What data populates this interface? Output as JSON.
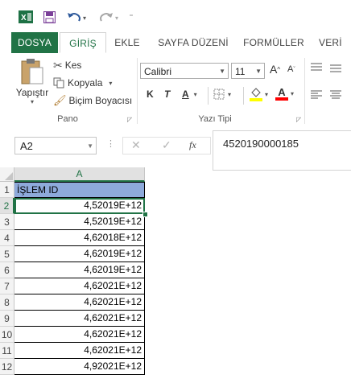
{
  "quick_access": {
    "excel_icon": "excel-logo-icon",
    "save_icon": "save-icon",
    "undo_icon": "undo-icon",
    "redo_icon": "redo-icon"
  },
  "tabs": [
    "DOSYA",
    "GİRİŞ",
    "EKLE",
    "SAYFA DÜZENİ",
    "FORMÜLLER",
    "VERİ"
  ],
  "ribbon": {
    "pano": {
      "paste_label": "Yapıştır",
      "cut_label": "Kes",
      "copy_label": "Kopyala",
      "format_painter_label": "Biçim Boyacısı",
      "group_label": "Pano"
    },
    "font": {
      "font_name": "Calibri",
      "font_size": "11",
      "bold": "K",
      "italic": "T",
      "underline": "A",
      "grow": "A",
      "shrink": "A",
      "font_color": "A",
      "group_label": "Yazı Tipi"
    }
  },
  "formula_bar": {
    "name_box": "A2",
    "fx": "fx",
    "value": "4520190000185"
  },
  "sheet": {
    "col_header": "A",
    "rows": [
      {
        "num": "1",
        "value": "İŞLEM ID"
      },
      {
        "num": "2",
        "value": "4,52019E+12"
      },
      {
        "num": "3",
        "value": "4,52019E+12"
      },
      {
        "num": "4",
        "value": "4,62018E+12"
      },
      {
        "num": "5",
        "value": "4,62019E+12"
      },
      {
        "num": "6",
        "value": "4,62019E+12"
      },
      {
        "num": "7",
        "value": "4,62021E+12"
      },
      {
        "num": "8",
        "value": "4,62021E+12"
      },
      {
        "num": "9",
        "value": "4,62021E+12"
      },
      {
        "num": "10",
        "value": "4,62021E+12"
      },
      {
        "num": "11",
        "value": "4,62021E+12"
      },
      {
        "num": "12",
        "value": "4,92021E+12"
      }
    ]
  },
  "colors": {
    "accent": "#217346",
    "header_fill": "#8eaadb",
    "font_color_bar": "#ff0000",
    "highlight_bar": "#ffff00"
  }
}
